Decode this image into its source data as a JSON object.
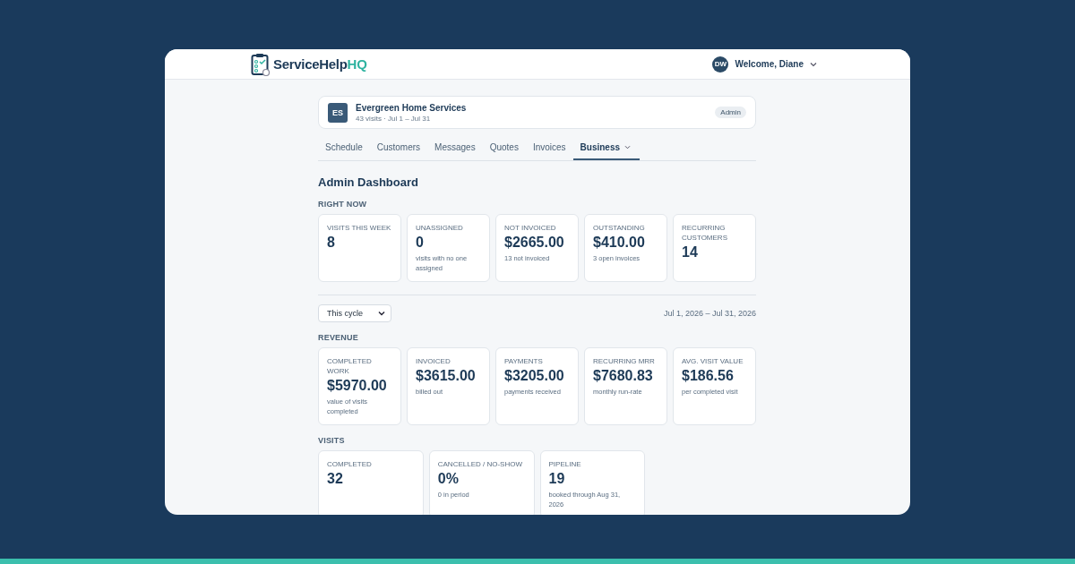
{
  "header": {
    "logo": {
      "name": "ServiceHelp",
      "accent": "HQ"
    },
    "user": {
      "initials": "DW",
      "greeting": "Welcome, Diane"
    }
  },
  "org": {
    "initials": "ES",
    "name": "Evergreen Home Services",
    "meta": "43 visits · Jul 1 – Jul 31",
    "role": "Admin"
  },
  "tabs": [
    {
      "label": "Schedule",
      "selected": false,
      "dropdown": false
    },
    {
      "label": "Customers",
      "selected": false,
      "dropdown": false
    },
    {
      "label": "Messages",
      "selected": false,
      "dropdown": false
    },
    {
      "label": "Quotes",
      "selected": false,
      "dropdown": false
    },
    {
      "label": "Invoices",
      "selected": false,
      "dropdown": false
    },
    {
      "label": "Business",
      "selected": true,
      "dropdown": true
    }
  ],
  "title": "Admin Dashboard",
  "right_now": {
    "heading": "RIGHT NOW",
    "cards": [
      {
        "label": "VISITS THIS WEEK",
        "value": "8"
      },
      {
        "label": "UNASSIGNED",
        "value": "0",
        "note": "visits with no one assigned"
      },
      {
        "label": "NOT INVOICED",
        "value": "$2665.00",
        "note": "13 not invoiced"
      },
      {
        "label": "OUTSTANDING",
        "value": "$410.00",
        "note": "3 open invoices"
      },
      {
        "label": "RECURRING CUSTOMERS",
        "value": "14"
      }
    ]
  },
  "period": {
    "select": "This cycle",
    "range": "Jul 1, 2026 – Jul 31, 2026"
  },
  "revenue": {
    "heading": "REVENUE",
    "cards": [
      {
        "label": "COMPLETED WORK",
        "value": "$5970.00",
        "note": "value of visits completed"
      },
      {
        "label": "INVOICED",
        "value": "$3615.00",
        "note": "billed out"
      },
      {
        "label": "PAYMENTS",
        "value": "$3205.00",
        "note": "payments received"
      },
      {
        "label": "RECURRING MRR",
        "value": "$7680.83",
        "note": "monthly run-rate"
      },
      {
        "label": "AVG. VISIT VALUE",
        "value": "$186.56",
        "note": "per completed visit"
      }
    ]
  },
  "visits": {
    "heading": "VISITS",
    "cards": [
      {
        "label": "COMPLETED",
        "value": "32"
      },
      {
        "label": "CANCELLED / NO-SHOW",
        "value": "0%",
        "note": "0 in period"
      },
      {
        "label": "PIPELINE",
        "value": "19",
        "note": "booked through Aug 31, 2026"
      }
    ]
  }
}
